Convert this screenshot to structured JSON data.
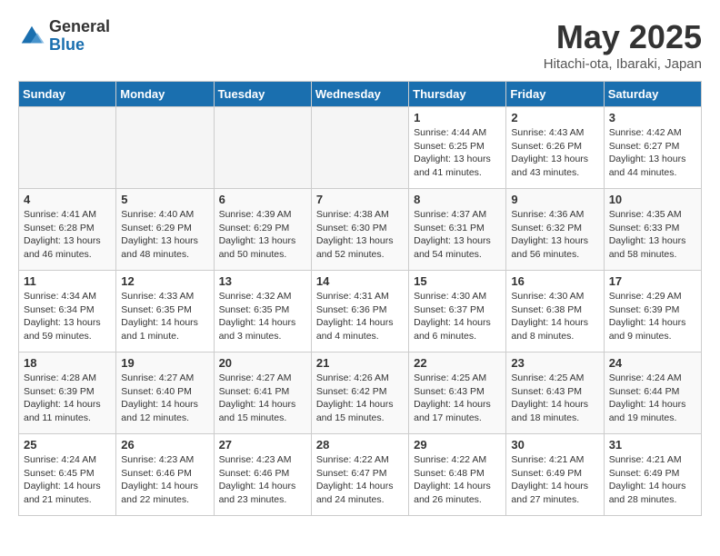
{
  "logo": {
    "general": "General",
    "blue": "Blue"
  },
  "title": "May 2025",
  "location": "Hitachi-ota, Ibaraki, Japan",
  "headers": [
    "Sunday",
    "Monday",
    "Tuesday",
    "Wednesday",
    "Thursday",
    "Friday",
    "Saturday"
  ],
  "rows": [
    [
      {
        "day": "",
        "info": ""
      },
      {
        "day": "",
        "info": ""
      },
      {
        "day": "",
        "info": ""
      },
      {
        "day": "",
        "info": ""
      },
      {
        "day": "1",
        "info": "Sunrise: 4:44 AM\nSunset: 6:25 PM\nDaylight: 13 hours\nand 41 minutes."
      },
      {
        "day": "2",
        "info": "Sunrise: 4:43 AM\nSunset: 6:26 PM\nDaylight: 13 hours\nand 43 minutes."
      },
      {
        "day": "3",
        "info": "Sunrise: 4:42 AM\nSunset: 6:27 PM\nDaylight: 13 hours\nand 44 minutes."
      }
    ],
    [
      {
        "day": "4",
        "info": "Sunrise: 4:41 AM\nSunset: 6:28 PM\nDaylight: 13 hours\nand 46 minutes."
      },
      {
        "day": "5",
        "info": "Sunrise: 4:40 AM\nSunset: 6:29 PM\nDaylight: 13 hours\nand 48 minutes."
      },
      {
        "day": "6",
        "info": "Sunrise: 4:39 AM\nSunset: 6:29 PM\nDaylight: 13 hours\nand 50 minutes."
      },
      {
        "day": "7",
        "info": "Sunrise: 4:38 AM\nSunset: 6:30 PM\nDaylight: 13 hours\nand 52 minutes."
      },
      {
        "day": "8",
        "info": "Sunrise: 4:37 AM\nSunset: 6:31 PM\nDaylight: 13 hours\nand 54 minutes."
      },
      {
        "day": "9",
        "info": "Sunrise: 4:36 AM\nSunset: 6:32 PM\nDaylight: 13 hours\nand 56 minutes."
      },
      {
        "day": "10",
        "info": "Sunrise: 4:35 AM\nSunset: 6:33 PM\nDaylight: 13 hours\nand 58 minutes."
      }
    ],
    [
      {
        "day": "11",
        "info": "Sunrise: 4:34 AM\nSunset: 6:34 PM\nDaylight: 13 hours\nand 59 minutes."
      },
      {
        "day": "12",
        "info": "Sunrise: 4:33 AM\nSunset: 6:35 PM\nDaylight: 14 hours\nand 1 minute."
      },
      {
        "day": "13",
        "info": "Sunrise: 4:32 AM\nSunset: 6:35 PM\nDaylight: 14 hours\nand 3 minutes."
      },
      {
        "day": "14",
        "info": "Sunrise: 4:31 AM\nSunset: 6:36 PM\nDaylight: 14 hours\nand 4 minutes."
      },
      {
        "day": "15",
        "info": "Sunrise: 4:30 AM\nSunset: 6:37 PM\nDaylight: 14 hours\nand 6 minutes."
      },
      {
        "day": "16",
        "info": "Sunrise: 4:30 AM\nSunset: 6:38 PM\nDaylight: 14 hours\nand 8 minutes."
      },
      {
        "day": "17",
        "info": "Sunrise: 4:29 AM\nSunset: 6:39 PM\nDaylight: 14 hours\nand 9 minutes."
      }
    ],
    [
      {
        "day": "18",
        "info": "Sunrise: 4:28 AM\nSunset: 6:39 PM\nDaylight: 14 hours\nand 11 minutes."
      },
      {
        "day": "19",
        "info": "Sunrise: 4:27 AM\nSunset: 6:40 PM\nDaylight: 14 hours\nand 12 minutes."
      },
      {
        "day": "20",
        "info": "Sunrise: 4:27 AM\nSunset: 6:41 PM\nDaylight: 14 hours\nand 15 minutes."
      },
      {
        "day": "21",
        "info": "Sunrise: 4:26 AM\nSunset: 6:42 PM\nDaylight: 14 hours\nand 15 minutes."
      },
      {
        "day": "22",
        "info": "Sunrise: 4:25 AM\nSunset: 6:43 PM\nDaylight: 14 hours\nand 17 minutes."
      },
      {
        "day": "23",
        "info": "Sunrise: 4:25 AM\nSunset: 6:43 PM\nDaylight: 14 hours\nand 18 minutes."
      },
      {
        "day": "24",
        "info": "Sunrise: 4:24 AM\nSunset: 6:44 PM\nDaylight: 14 hours\nand 19 minutes."
      }
    ],
    [
      {
        "day": "25",
        "info": "Sunrise: 4:24 AM\nSunset: 6:45 PM\nDaylight: 14 hours\nand 21 minutes."
      },
      {
        "day": "26",
        "info": "Sunrise: 4:23 AM\nSunset: 6:46 PM\nDaylight: 14 hours\nand 22 minutes."
      },
      {
        "day": "27",
        "info": "Sunrise: 4:23 AM\nSunset: 6:46 PM\nDaylight: 14 hours\nand 23 minutes."
      },
      {
        "day": "28",
        "info": "Sunrise: 4:22 AM\nSunset: 6:47 PM\nDaylight: 14 hours\nand 24 minutes."
      },
      {
        "day": "29",
        "info": "Sunrise: 4:22 AM\nSunset: 6:48 PM\nDaylight: 14 hours\nand 26 minutes."
      },
      {
        "day": "30",
        "info": "Sunrise: 4:21 AM\nSunset: 6:49 PM\nDaylight: 14 hours\nand 27 minutes."
      },
      {
        "day": "31",
        "info": "Sunrise: 4:21 AM\nSunset: 6:49 PM\nDaylight: 14 hours\nand 28 minutes."
      }
    ]
  ]
}
